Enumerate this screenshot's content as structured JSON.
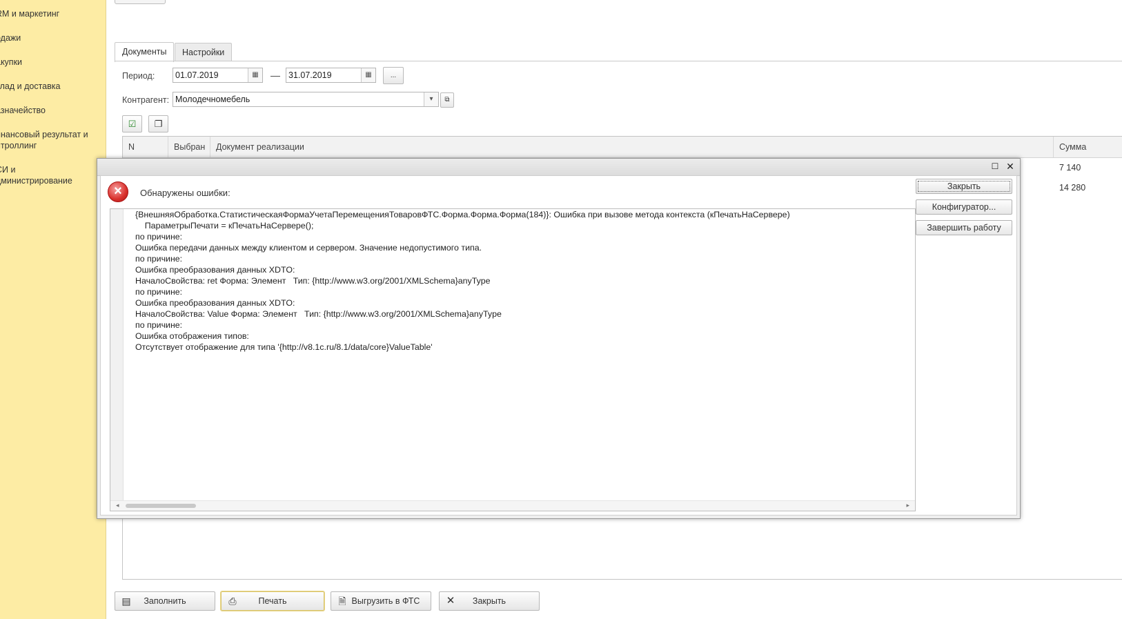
{
  "sidebar": {
    "items": [
      {
        "label": "RM и маркетинг"
      },
      {
        "label": "одажи"
      },
      {
        "label": "акупки"
      },
      {
        "label": "клад и доставка"
      },
      {
        "label": "азначейство"
      },
      {
        "label": "инансовый результат и\nнтроллинг"
      },
      {
        "label": "СИ и\nдминистрирование"
      }
    ]
  },
  "tabs": [
    {
      "label": "Документы"
    },
    {
      "label": "Настройки"
    }
  ],
  "filters": {
    "period_label": "Период:",
    "date_from": "01.07.2019",
    "dash": "—",
    "date_to": "31.07.2019",
    "more_label": "...",
    "counterparty_label": "Контрагент:",
    "counterparty_value": "Молодечномебель"
  },
  "grid": {
    "columns": [
      "N",
      "Выбран",
      "Документ реализации",
      "Сумма"
    ],
    "sums": [
      "7 140",
      "14 280"
    ]
  },
  "dialog": {
    "title": "Обнаружены ошибки:",
    "message_lines": [
      "{ВнешняяОбработка.СтатистическаяФормаУчетаПеремещенияТоваровФТС.Форма.Форма.Форма(184)}: Ошибка при вызове метода контекста (кПечатьНаСервере)",
      "    ПараметрыПечати = кПечатьНаСервере();",
      "по причине:",
      "Ошибка передачи данных между клиентом и сервером. Значение недопустимого типа.",
      "по причине:",
      "Ошибка преобразования данных XDTO:",
      "НачалоСвойства: ret Форма: Элемент   Тип: {http://www.w3.org/2001/XMLSchema}anyType",
      "по причине:",
      "Ошибка преобразования данных XDTO:",
      "НачалоСвойства: Value Форма: Элемент   Тип: {http://www.w3.org/2001/XMLSchema}anyType",
      "по причине:",
      "Ошибка отображения типов:",
      "Отсутствует отображение для типа '{http://v8.1c.ru/8.1/data/core}ValueTable'"
    ],
    "buttons": {
      "close": "Закрыть",
      "configurator": "Конфигуратор...",
      "exit": "Завершить работу"
    }
  },
  "bottom_buttons": {
    "fill": "Заполнить",
    "print": "Печать",
    "export": "Выгрузить в ФТС",
    "close": "Закрыть"
  }
}
